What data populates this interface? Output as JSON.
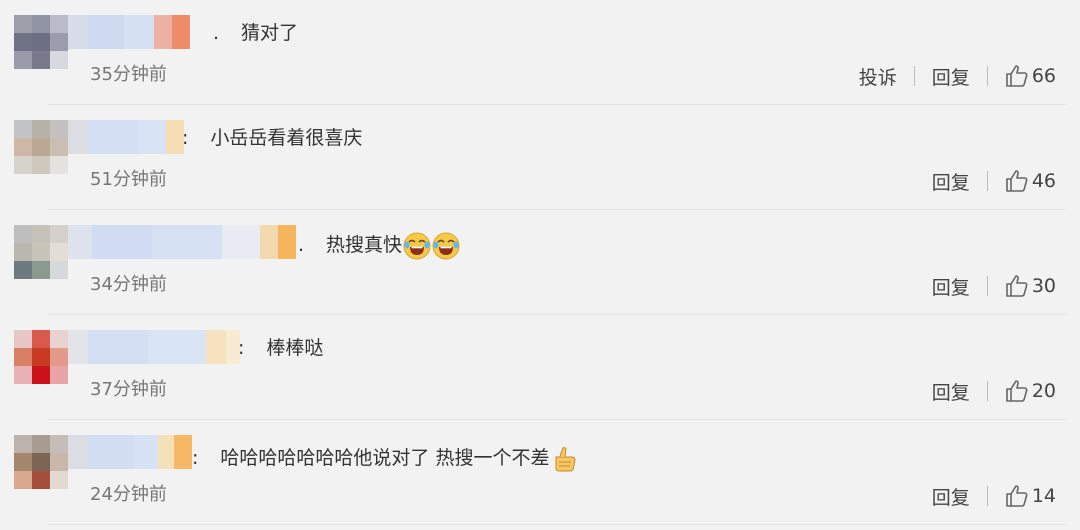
{
  "colors": {
    "background": "#f2f2f2",
    "text": "#333333",
    "time": "#777777",
    "action": "#444444",
    "divider": "#e2e2e2"
  },
  "comments": [
    {
      "separator": ".",
      "text": "猜对了",
      "time": "35分钟前",
      "report": "投诉",
      "reply": "回复",
      "likes": "66",
      "emoji": []
    },
    {
      "separator": ":",
      "text": "小岳岳看着很喜庆",
      "time": "51分钟前",
      "reply": "回复",
      "likes": "46",
      "emoji": []
    },
    {
      "separator": ".",
      "text": "热搜真快",
      "time": "34分钟前",
      "reply": "回复",
      "likes": "30",
      "emoji": [
        "laughing-crying-emoji",
        "laughing-crying-emoji"
      ]
    },
    {
      "separator": ":",
      "text": "棒棒哒",
      "time": "37分钟前",
      "reply": "回复",
      "likes": "20",
      "emoji": []
    },
    {
      "separator": ":",
      "text": "哈哈哈哈哈哈哈他说对了 热搜一个不差",
      "time": "24分钟前",
      "reply": "回复",
      "likes": "14",
      "emoji": [
        "thumbs-up-emoji"
      ]
    }
  ]
}
